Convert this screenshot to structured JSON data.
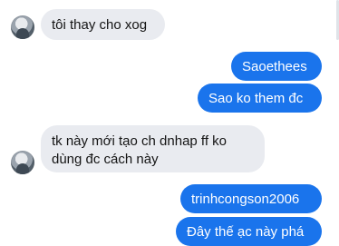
{
  "conversation": {
    "messages": [
      {
        "direction": "incoming",
        "text": "tôi thay cho xog"
      },
      {
        "direction": "outgoing",
        "text": "Saoethees"
      },
      {
        "direction": "outgoing",
        "text": "Sao ko them đc"
      },
      {
        "direction": "incoming",
        "text": "tk này mới tạo ch dnhap ff ko\ndùng đc cách này"
      },
      {
        "direction": "outgoing",
        "text": "trinhcongson2006"
      },
      {
        "direction": "outgoing",
        "text": "Đây thế ạc này phá"
      }
    ]
  },
  "colors": {
    "outgoing_bubble": "#1a74ec",
    "incoming_bubble": "#e9ebf0",
    "background": "#ffffff"
  },
  "icons": {
    "avatar": "avatar-icon"
  }
}
